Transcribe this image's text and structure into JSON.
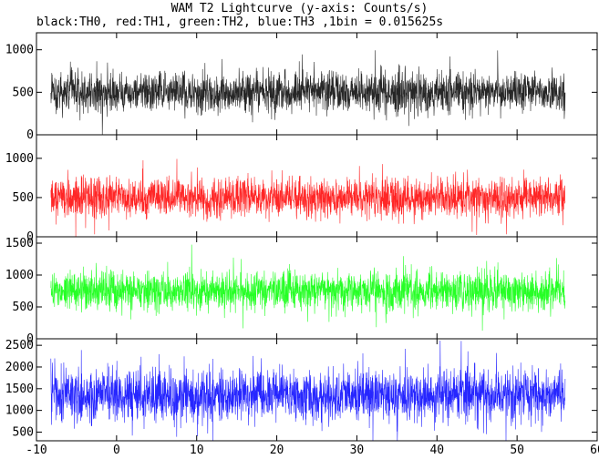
{
  "title": "WAM T2 Lightcurve (y-axis: Counts/s)",
  "subtitle": "black:TH0, red:TH1, green:TH2, blue:TH3 ,1bin = 0.015625s",
  "chart_data": [
    {
      "type": "line",
      "panel": "TH0",
      "color": "#000000",
      "x_range": [
        -8.2,
        56.0
      ],
      "baseline": 500,
      "spread": 120,
      "ylim": [
        0,
        1200
      ],
      "yticks": [
        0,
        500,
        1000
      ],
      "ytick_labels": [
        "0",
        "500",
        "1000"
      ]
    },
    {
      "type": "line",
      "panel": "TH1",
      "color": "#ff0000",
      "x_range": [
        -8.2,
        56.0
      ],
      "baseline": 500,
      "spread": 125,
      "ylim": [
        0,
        1300
      ],
      "yticks": [
        0,
        500,
        1000
      ],
      "ytick_labels": [
        "0",
        "500",
        "1000"
      ]
    },
    {
      "type": "line",
      "panel": "TH2",
      "color": "#00ff00",
      "x_range": [
        -8.2,
        56.0
      ],
      "baseline": 750,
      "spread": 150,
      "ylim": [
        0,
        1600
      ],
      "yticks": [
        0,
        500,
        1000,
        1500
      ],
      "ytick_labels": [
        "0",
        "500",
        "1000",
        "1500"
      ]
    },
    {
      "type": "line",
      "panel": "TH3",
      "color": "#0000ff",
      "x_range": [
        -8.2,
        56.0
      ],
      "baseline": 1350,
      "spread": 300,
      "ylim": [
        300,
        2650
      ],
      "yticks": [
        500,
        1000,
        1500,
        2000,
        2500
      ],
      "ytick_labels": [
        "500",
        "1000",
        "1500",
        "2000",
        "2500"
      ]
    }
  ],
  "x_axis": {
    "xlim": [
      -10,
      60
    ],
    "ticks": [
      -10,
      0,
      10,
      20,
      30,
      40,
      50,
      60
    ],
    "tick_labels": [
      "-10",
      "0",
      "10",
      "20",
      "30",
      "40",
      "50",
      "60"
    ]
  }
}
